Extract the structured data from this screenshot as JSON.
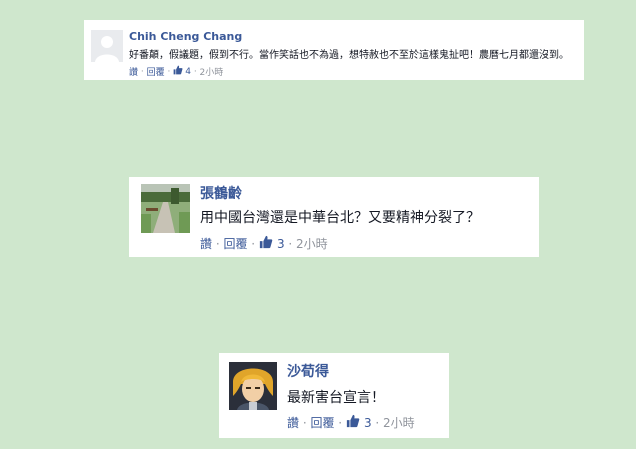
{
  "background_color": "#cfe7cd",
  "link_color": "#3b5998",
  "comments": [
    {
      "author": "Chih Cheng Chang",
      "avatar": "default-silhouette-avatar",
      "text": "好番顛，假議題，假到不行。當作笑話也不為過，想特赦也不至於這樣鬼扯吧！農曆七月都還沒到。",
      "reply_label": "讚",
      "respond_label": "回覆",
      "like_count": "4",
      "time": "2小時"
    },
    {
      "author": "張鶴齡",
      "avatar": "park-path-photo-avatar",
      "text": "用中國台灣還是中華台北？又要精神分裂了？",
      "reply_label": "讚",
      "respond_label": "回覆",
      "like_count": "3",
      "time": "2小時"
    },
    {
      "author": "沙荀得",
      "avatar": "anime-character-avatar",
      "text": "最新害台宣言！",
      "reply_label": "讚",
      "respond_label": "回覆",
      "like_count": "3",
      "time": "2小時"
    }
  ]
}
